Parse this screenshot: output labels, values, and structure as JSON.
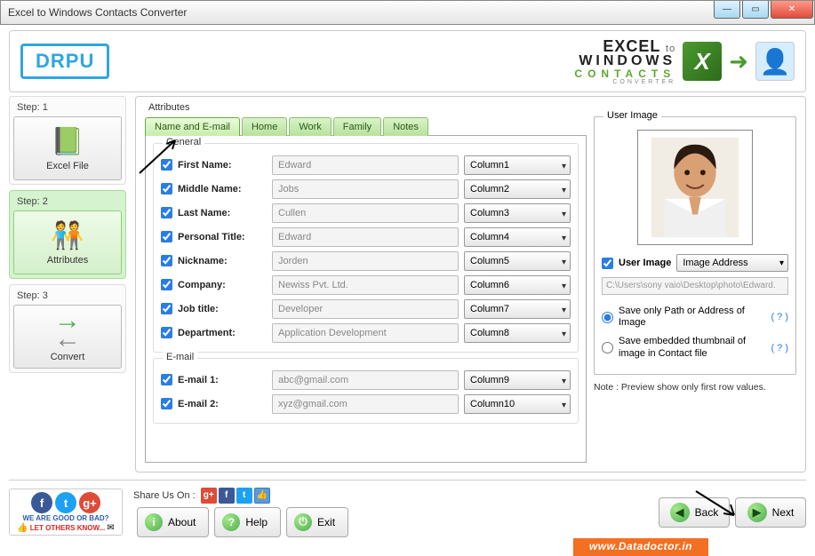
{
  "window": {
    "title": "Excel to Windows Contacts Converter"
  },
  "logo": "DRPU",
  "brand": {
    "l1a": "EXCEL",
    "l1b": "to",
    "l2": "WINDOWS",
    "l3": "CONTACTS",
    "l4": "CONVERTER"
  },
  "steps": {
    "s1": {
      "label": "Step: 1",
      "btn": "Excel File"
    },
    "s2": {
      "label": "Step: 2",
      "btn": "Attributes"
    },
    "s3": {
      "label": "Step: 3",
      "btn": "Convert"
    }
  },
  "attributes_label": "Attributes",
  "tabs": [
    "Name and E-mail",
    "Home",
    "Work",
    "Family",
    "Notes"
  ],
  "general": {
    "legend": "General",
    "rows": [
      {
        "label": "First Name:",
        "value": "Edward",
        "col": "Column1"
      },
      {
        "label": "Middle Name:",
        "value": "Jobs",
        "col": "Column2"
      },
      {
        "label": "Last Name:",
        "value": "Cullen",
        "col": "Column3"
      },
      {
        "label": "Personal Title:",
        "value": "Edward",
        "col": "Column4"
      },
      {
        "label": "Nickname:",
        "value": "Jorden",
        "col": "Column5"
      },
      {
        "label": "Company:",
        "value": "Newiss Pvt. Ltd.",
        "col": "Column6"
      },
      {
        "label": "Job title:",
        "value": "Developer",
        "col": "Column7"
      },
      {
        "label": "Department:",
        "value": "Application Development",
        "col": "Column8"
      }
    ]
  },
  "email": {
    "legend": "E-mail",
    "rows": [
      {
        "label": "E-mail 1:",
        "value": "abc@gmail.com",
        "col": "Column9"
      },
      {
        "label": "E-mail 2:",
        "value": "xyz@gmail.com",
        "col": "Column10"
      }
    ]
  },
  "userimage": {
    "legend": "User Image",
    "check_label": "User Image",
    "dropdown": "Image Address",
    "path": "C:\\Users\\sony vaio\\Desktop\\photo\\Edward.",
    "opt1": "Save only Path or Address of Image",
    "opt2": "Save embedded thumbnail of image in Contact file",
    "q": "( ? )",
    "note": "Note : Preview show only first row values."
  },
  "footer": {
    "share_label": "Share Us On :",
    "about": "About",
    "help": "Help",
    "exit": "Exit",
    "back": "Back",
    "next": "Next",
    "good_bad": "WE ARE GOOD OR BAD?",
    "let_others": "LET OTHERS KNOW..."
  },
  "watermark": "www.Datadoctor.in"
}
